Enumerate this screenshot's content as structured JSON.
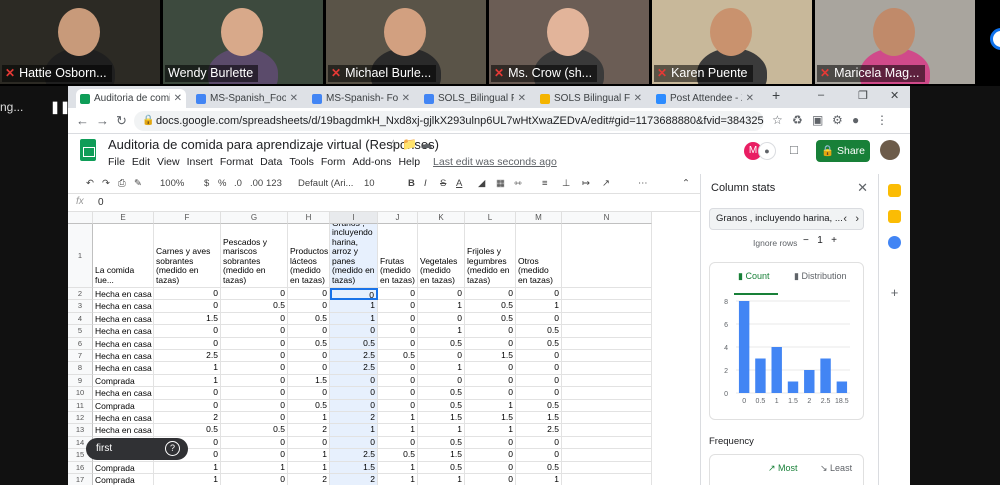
{
  "participants": [
    {
      "name": "Hattie Osborn...",
      "muted": true,
      "bg": "#2c2a24"
    },
    {
      "name": "Wendy Burlette",
      "muted": false,
      "bg": "#3d4a3e"
    },
    {
      "name": "Michael Burle...",
      "muted": true,
      "bg": "#5a5448"
    },
    {
      "name": "Ms. Crow (sh...",
      "muted": true,
      "bg": "#6b5d55"
    },
    {
      "name": "Karen Puente",
      "muted": true,
      "bg": "#c8b89a"
    },
    {
      "name": "Maricela Mag...",
      "muted": true,
      "bg": "#a9a59e"
    }
  ],
  "left_label": "ng...",
  "browser": {
    "tabs": [
      {
        "label": "Auditoria de comida",
        "color": "#0f9d58",
        "active": true
      },
      {
        "label": "MS-Spanish_Food W",
        "color": "#4285f4"
      },
      {
        "label": "MS-Spanish- Food A",
        "color": "#4285f4"
      },
      {
        "label": "SOLS_Bilingual Food",
        "color": "#4285f4"
      },
      {
        "label": "SOLS Bilingual Food",
        "color": "#f4b400"
      },
      {
        "label": "Post Attendee - Zoo",
        "color": "#2d8cff"
      }
    ],
    "new_tab": "+",
    "url": "docs.google.com/spreadsheets/d/19bagdmkH_Nxd8xj-gjlkX293ulnp6UL7wHtXwaZEDvA/edit#gid=1173688880&fvid=384325226"
  },
  "sheet": {
    "title": "Auditoria de comida para aprendizaje virtual (Responses)",
    "menu": [
      "File",
      "Edit",
      "View",
      "Insert",
      "Format",
      "Data",
      "Tools",
      "Form",
      "Add-ons",
      "Help"
    ],
    "last_edit": "Last edit was seconds ago",
    "share": "Share",
    "avatar_letter": "M",
    "toolbar": {
      "zoom": "100%",
      "currency": "$",
      "percent": "%",
      "dec0": ".0",
      "dec00": ".00",
      "format": "123",
      "font": "Default (Ari...",
      "size": "10",
      "bold": "B",
      "italic": "I",
      "strike": "S",
      "textcolor": "A"
    },
    "formula_value": "0",
    "fx": "fx",
    "columns": [
      "E",
      "F",
      "G",
      "H",
      "I",
      "J",
      "K",
      "L",
      "M",
      "N"
    ],
    "header_row": "1",
    "headers": [
      "La comida fue...",
      "Carnes y aves sobrantes (medido en tazas)",
      "Pescados y mariscos sobrantes (medido en tazas)",
      "Productos lácteos (medido en tazas)",
      "Granos , incluyendo harina, arroz y panes (medido en tazas)",
      "Frutas (medido en tazas)",
      "Vegetales (medido en tazas)",
      "Frijoles y legumbres (medido en tazas)",
      "Otros (medido en tazas)",
      ""
    ],
    "rows": [
      {
        "n": "2",
        "e": "Hecha en casa",
        "v": [
          "0",
          "0",
          "0",
          "0",
          "0",
          "0",
          "0",
          "0"
        ]
      },
      {
        "n": "3",
        "e": "Hecha en casa",
        "v": [
          "0",
          "0.5",
          "0",
          "1",
          "0",
          "1",
          "0.5",
          "1"
        ]
      },
      {
        "n": "4",
        "e": "Hecha en casa",
        "v": [
          "1.5",
          "0",
          "0.5",
          "1",
          "0",
          "0",
          "0.5",
          "0"
        ]
      },
      {
        "n": "5",
        "e": "Hecha en casa",
        "v": [
          "0",
          "0",
          "0",
          "0",
          "0",
          "1",
          "0",
          "0.5"
        ]
      },
      {
        "n": "6",
        "e": "Hecha en casa",
        "v": [
          "0",
          "0",
          "0.5",
          "0.5",
          "0",
          "0.5",
          "0",
          "0.5"
        ]
      },
      {
        "n": "7",
        "e": "Hecha en casa",
        "v": [
          "2.5",
          "0",
          "0",
          "2.5",
          "0.5",
          "0",
          "1.5",
          "0"
        ]
      },
      {
        "n": "8",
        "e": "Hecha en casa",
        "v": [
          "1",
          "0",
          "0",
          "2.5",
          "0",
          "1",
          "0",
          "0"
        ]
      },
      {
        "n": "9",
        "e": "Comprada",
        "v": [
          "1",
          "0",
          "1.5",
          "0",
          "0",
          "0",
          "0",
          "0"
        ]
      },
      {
        "n": "10",
        "e": "Hecha en casa",
        "v": [
          "0",
          "0",
          "0",
          "0",
          "0",
          "0.5",
          "0",
          "0"
        ]
      },
      {
        "n": "11",
        "e": "Comprada",
        "v": [
          "0",
          "0",
          "0.5",
          "0",
          "0",
          "0.5",
          "1",
          "0.5"
        ]
      },
      {
        "n": "12",
        "e": "Hecha en casa",
        "v": [
          "2",
          "0",
          "1",
          "2",
          "1",
          "1.5",
          "1.5",
          "1.5"
        ]
      },
      {
        "n": "13",
        "e": "Hecha en casa",
        "v": [
          "0.5",
          "0.5",
          "2",
          "1",
          "1",
          "1",
          "1",
          "2.5"
        ]
      },
      {
        "n": "14",
        "e": "Hecha en casa",
        "v": [
          "0",
          "0",
          "0",
          "0",
          "0",
          "0.5",
          "0",
          "0"
        ]
      },
      {
        "n": "15",
        "e": "Hecha en casa",
        "v": [
          "0",
          "0",
          "1",
          "2.5",
          "0.5",
          "1.5",
          "0",
          "0"
        ]
      },
      {
        "n": "16",
        "e": "Comprada",
        "v": [
          "1",
          "1",
          "1",
          "1.5",
          "1",
          "0.5",
          "0",
          "0.5"
        ]
      },
      {
        "n": "17",
        "e": "Comprada",
        "v": [
          "1",
          "0",
          "2",
          "2",
          "1",
          "1",
          "0",
          "1"
        ]
      }
    ]
  },
  "tooltip": "first",
  "stats": {
    "title": "Column stats",
    "column": "Granos , incluyendo harina, ...",
    "ignore_label": "Ignore rows",
    "ignore_value": "1",
    "tab_count": "Count",
    "tab_distribution": "Distribution",
    "frequency": "Frequency",
    "most": "Most",
    "least": "Least",
    "chart_data": {
      "type": "bar",
      "categories": [
        "0",
        "0.5",
        "1",
        "1.5",
        "2",
        "2.5",
        "18.5"
      ],
      "values": [
        8,
        3,
        4,
        1,
        2,
        3,
        1
      ],
      "ylim": [
        0,
        8
      ],
      "yticks": [
        "0",
        "2",
        "4",
        "6",
        "8"
      ],
      "color": "#4285f4"
    }
  }
}
